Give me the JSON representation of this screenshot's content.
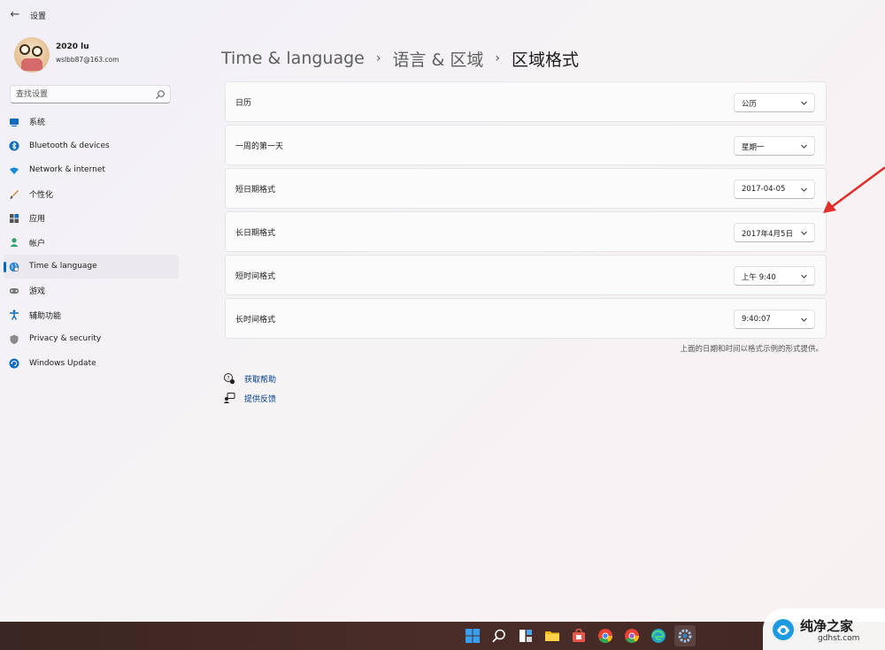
{
  "window": {
    "title": "设置"
  },
  "profile": {
    "name": "2020 lu",
    "email": "wslbb87@163.com"
  },
  "search": {
    "placeholder": "查找设置"
  },
  "sidebar": {
    "items": [
      {
        "label": "系统",
        "icon": "system-icon",
        "selected": false
      },
      {
        "label": "Bluetooth & devices",
        "icon": "bluetooth-icon",
        "selected": false
      },
      {
        "label": "Network & internet",
        "icon": "wifi-icon",
        "selected": false
      },
      {
        "label": "个性化",
        "icon": "brush-icon",
        "selected": false
      },
      {
        "label": "应用",
        "icon": "apps-icon",
        "selected": false
      },
      {
        "label": "帐户",
        "icon": "account-icon",
        "selected": false
      },
      {
        "label": "Time & language",
        "icon": "globe-clock-icon",
        "selected": true
      },
      {
        "label": "游戏",
        "icon": "gamepad-icon",
        "selected": false
      },
      {
        "label": "辅助功能",
        "icon": "accessibility-icon",
        "selected": false
      },
      {
        "label": "Privacy & security",
        "icon": "shield-icon",
        "selected": false
      },
      {
        "label": "Windows Update",
        "icon": "update-icon",
        "selected": false
      }
    ]
  },
  "breadcrumb": {
    "level1": "Time & language",
    "level2": "语言 & 区域",
    "current": "区域格式",
    "separator": "›"
  },
  "settings": {
    "rows": [
      {
        "label": "日历",
        "value": "公历"
      },
      {
        "label": "一周的第一天",
        "value": "星期一"
      },
      {
        "label": "短日期格式",
        "value": "2017-04-05"
      },
      {
        "label": "长日期格式",
        "value": "2017年4月5日"
      },
      {
        "label": "短时间格式",
        "value": "上午 9:40"
      },
      {
        "label": "长时间格式",
        "value": "9:40:07"
      }
    ],
    "footnote": "上面的日期和时间以格式示例的形式提供。"
  },
  "links": {
    "help": "获取帮助",
    "feedback": "提供反馈"
  },
  "taskbar": {
    "icons": [
      "windows-start-icon",
      "search-icon",
      "task-view-icon",
      "file-explorer-icon",
      "store-icon",
      "chrome-icon",
      "chrome-canary-icon",
      "edge-icon",
      "settings-icon"
    ]
  },
  "watermark": {
    "title": "纯净之家",
    "url": "gdhst.com"
  },
  "colors": {
    "accent": "#0067c0",
    "link": "#003e92",
    "annotation_arrow": "#e0302a"
  }
}
